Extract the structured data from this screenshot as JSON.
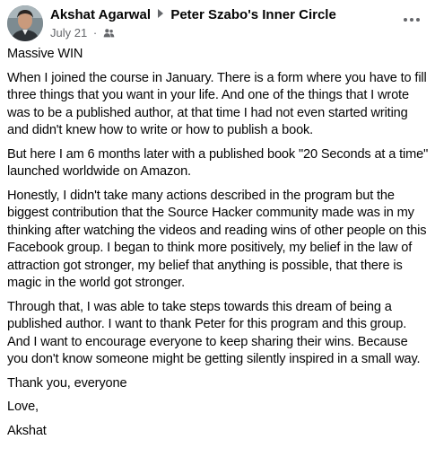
{
  "post": {
    "author": "Akshat Agarwal",
    "group": "Peter Szabo's Inner Circle",
    "date": "July 21",
    "separator": "·",
    "privacy_icon": "group-members-icon",
    "more_icon": "ellipsis-icon",
    "paragraphs": [
      "Massive WIN",
      "When I joined the course in January. There is a form where you have to fill three things that you want in your life. And one of the things that I wrote was to be a published author, at that time I had not even started writing and didn't knew how to write or how to publish a book.",
      "But here I am 6 months later with a published book \"20 Seconds at a time\" launched worldwide on Amazon.",
      "Honestly, I didn't take many actions described in the program but the biggest contribution that the Source Hacker community made was in my thinking after watching the videos and reading wins of other people on this Facebook group. I began to think more positively, my belief in the law of attraction got stronger, my belief that anything is possible, that there is magic in the world got stronger.",
      "Through that, I was able to take steps towards this dream of being a published author. I want to thank Peter for this program and this group. And I want to encourage everyone to keep sharing their wins. Because you don't know someone might be getting silently inspired in a small way.",
      "Thank you, everyone",
      "Love,",
      "Akshat"
    ]
  }
}
